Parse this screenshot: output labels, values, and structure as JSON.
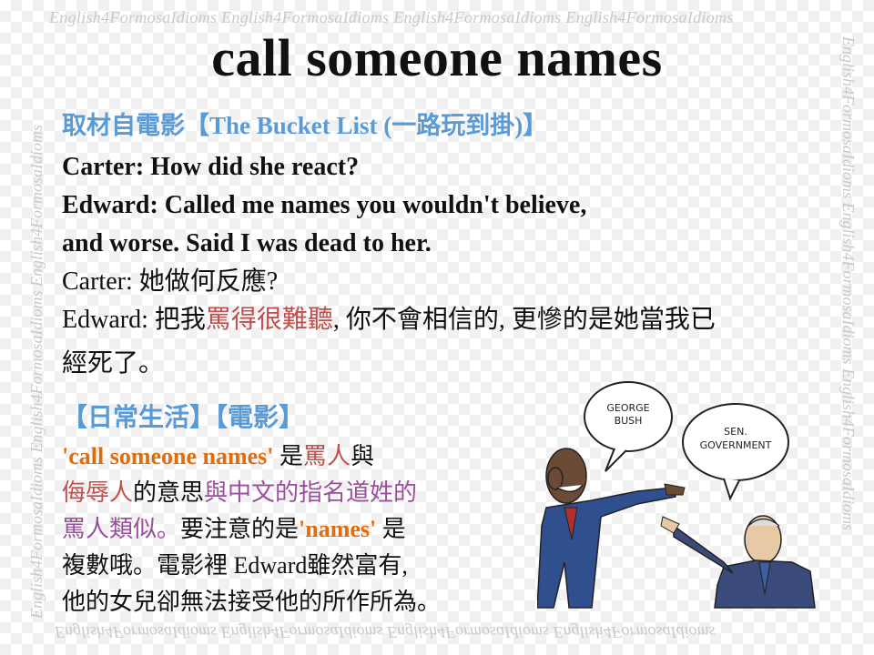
{
  "watermark": {
    "top": "English4FormosaIdioms  English4FormosaIdioms  English4FormosaIdioms  English4FormosaIdioms",
    "bottom": "English4FormosaIdioms  English4FormosaIdioms  English4FormosaIdioms  English4FormosaIdioms",
    "left": "English4FormosaIdioms  English4FormosaIdioms  English4FormosaIdioms",
    "right": "English4FormosaIdioms  English4FormosaIdioms  English4FormosaIdioms"
  },
  "title": "call someone names",
  "source": "取材自電影【The Bucket List (一路玩到掛)】",
  "dialog": {
    "l1": "Carter: How did she react?",
    "l2": "Edward: Called me names you wouldn't believe,",
    "l3": "and worse. Said I was dead to her.",
    "l4": "Carter: 她做何反應?",
    "l5_a": "Edward: 把我",
    "l5_red": "罵得很難聽",
    "l5_b": ", 你不會相信的, 更慘的是她當我已",
    "l6": "經死了。"
  },
  "section": "【日常生活】【電影】",
  "explain": {
    "p1": "'call someone names'",
    "p2": " 是",
    "p3": "罵人",
    "p4": "與",
    "p5": "侮辱人",
    "p6": "的意思",
    "p7": "與中文的指名道姓的",
    "p8": "罵人類似。",
    "p9": "要注意的是",
    "p10": "'names'",
    "p11": " 是",
    "p12": "複數哦。電影裡 Edward雖然富有,",
    "p13": "他的女兒卻無法接受他的所作所為。"
  },
  "cartoon": {
    "bubble_left": [
      "GEORGE",
      "BUSH"
    ],
    "bubble_right": [
      "SEN.",
      "GOVERNMENT"
    ]
  },
  "colors": {
    "blue_heading": "#5b9bd5",
    "red_text": "#c0504d",
    "orange_text": "#e36c0a"
  }
}
